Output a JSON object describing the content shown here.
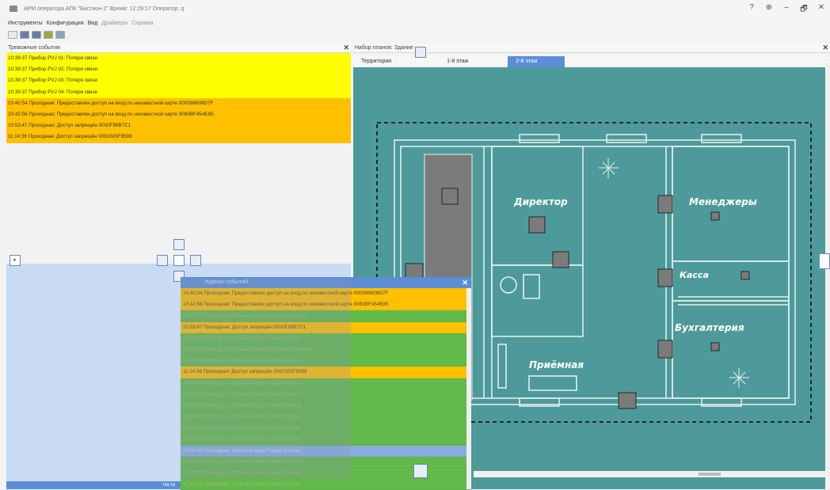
{
  "window": {
    "title": "АРМ оператора АПК \"Бастион-2\" Время: 12:29:17 Оператор: q",
    "controls": [
      "?",
      "⊕",
      "–",
      "🗗",
      "✕"
    ]
  },
  "menu": [
    "Инструменты",
    "Конфигурация",
    "Вид",
    "Драйверы",
    "Справка"
  ],
  "alarm_panel": {
    "title": "Тревожные события",
    "close": "✕",
    "rows": [
      {
        "text": "10:39:37 Прибор PVJ 01: Потеря связи",
        "color": "yellow"
      },
      {
        "text": "10:39:37 Прибор PVJ 02: Потеря связи",
        "color": "yellow"
      },
      {
        "text": "10:39:37 Прибор PVJ 03: Потеря связи",
        "color": "yellow"
      },
      {
        "text": "10:39:37 Прибор PVJ 04: Потеря связи",
        "color": "yellow"
      },
      {
        "text": "10:40:54 Проходная: Предоставлен доступ на вход по неизвестной карте 000098608D7F",
        "color": "orange"
      },
      {
        "text": "10:42:56 Проходная: Предоставлен доступ на вход по неизвестной карте 0080BF454E85",
        "color": "orange"
      },
      {
        "text": "10:53:47 Проходная: Доступ запрещён 0000F99B7C1",
        "color": "orange"
      },
      {
        "text": "11:14:36 Проходная: Доступ запрещён 0081505F9588",
        "color": "orange"
      }
    ]
  },
  "plan_panel": {
    "title": "Набор планов: Здание",
    "close": "✕",
    "tabs": [
      {
        "label": "Территория",
        "active": false
      },
      {
        "label": "1-й этаж",
        "active": false
      },
      {
        "label": "2-й этаж",
        "active": true
      }
    ],
    "rooms": [
      "Директор",
      "Менеджеры",
      "Касса",
      "Бухгалтерия",
      "Приёмная"
    ]
  },
  "journal": {
    "title": "Журнал событий",
    "close": "✕",
    "rows": [
      {
        "text": "10:40:54 Проходная: Предоставлен доступ на вход по неизвестной карте 000098608D7F",
        "type": "o"
      },
      {
        "text": "10:42:56 Проходная: Предоставлен доступ на вход по неизвестной карте 0080BF454E85",
        "type": "o"
      },
      {
        "text": "10:43:57 Проходная: Штатный вход Куртина Аппарель",
        "type": "g"
      },
      {
        "text": "10:53:47 Проходная: Доступ запрещён 0000F99B7C1",
        "type": "o"
      },
      {
        "text": "10:43:46 Проходная: Штатный вход Гласис Валганг",
        "type": "g"
      },
      {
        "text": "10:53:58 Проходная: Штатный выход Куртина Аппарель",
        "type": "g"
      },
      {
        "text": "10:43:46 Проходная: Штатный вход Гласис Валганг",
        "type": "g"
      },
      {
        "text": "11:14:36 Проходная: Доступ запрещён 0081505F9588",
        "type": "o"
      },
      {
        "text": "10:43:46 Проходная: Штатный вход Гласис Валганг",
        "type": "g"
      },
      {
        "text": "10:43:46 Проходная: Штатный вход Гласис Валганг",
        "type": "g"
      },
      {
        "text": "10:43:46 Проходная: Штатный вход Гласис Валганг",
        "type": "g"
      },
      {
        "text": "10:43:46 Проходная: Штатный вход Гласис Валганг",
        "type": "g"
      },
      {
        "text": "10:43:46 Проходная: Штатный вход Гласис Валганг",
        "type": "g"
      },
      {
        "text": "10:43:46 Проходная: Штатный вход Гласис Валганг",
        "type": "g"
      },
      {
        "text": "10:43:46 Проходная: Штатный вход Гласис Валганг",
        "type": "sel"
      },
      {
        "text": "10:43:46 Проходная: Штатный вход Гласис Валганг",
        "type": "g"
      },
      {
        "text": "10:43:46 Проходная: Штатный вход Гласис Валганг",
        "type": "g"
      },
      {
        "text": "10:43:46 Проходная: Штатный вход Гласис Валганг",
        "type": "g"
      }
    ]
  },
  "status": {
    "text": "На те"
  },
  "colors": {
    "yellow": "#ffff00",
    "orange": "#ffc000",
    "green": "#63b94a",
    "selected": "#86aede",
    "map": "#4e9a9a",
    "accent": "#5b8ed6"
  }
}
